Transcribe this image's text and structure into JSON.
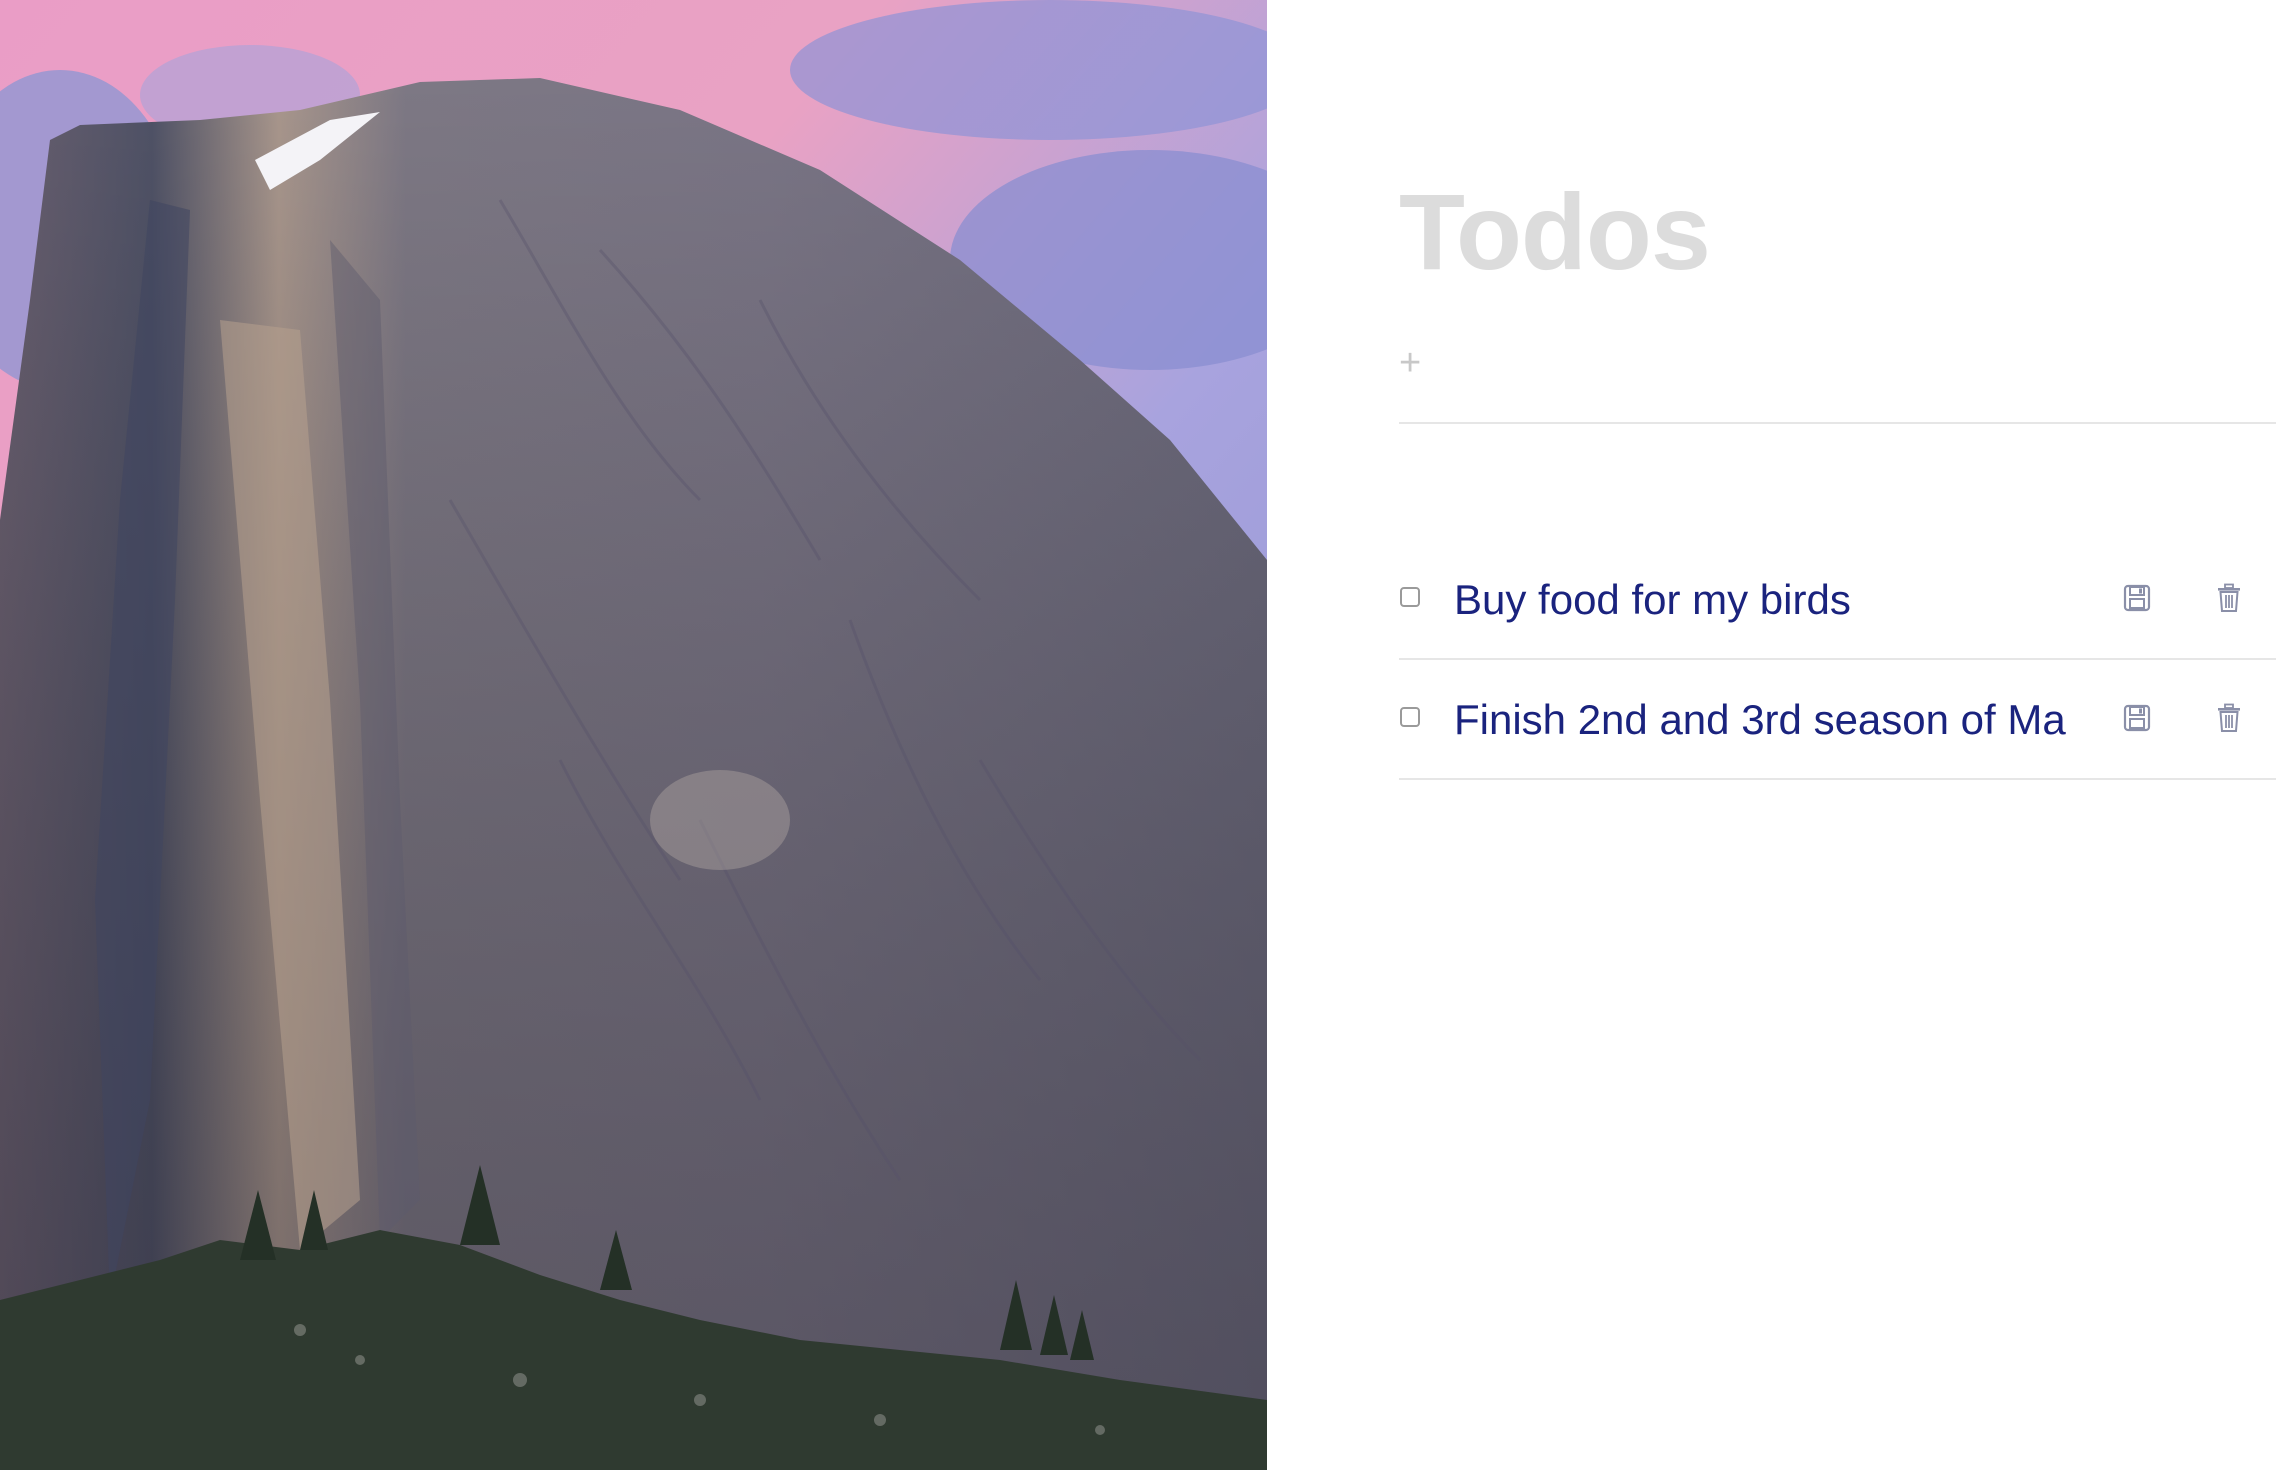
{
  "hero": {
    "image": "half-dome-yosemite-photo",
    "colors": {
      "sky_pink": "#e9a2c4",
      "sky_lavender": "#9aa0dc",
      "rock": "#6e6a7a",
      "rock_light": "#a29a98",
      "trees": "#2f3a30"
    }
  },
  "panel": {
    "title": "Todos",
    "add": {
      "icon": "plus-icon",
      "placeholder": "",
      "value": ""
    },
    "todos": [
      {
        "text": "Buy food for my birds",
        "completed": false,
        "save_icon": "floppy-disk-icon",
        "delete_icon": "trash-icon"
      },
      {
        "text": "Finish 2nd and 3rd season of Ma",
        "completed": false,
        "save_icon": "floppy-disk-icon",
        "delete_icon": "trash-icon"
      }
    ]
  },
  "colors": {
    "title": "#dcdcdc",
    "todo_text": "#1a237e",
    "divider": "#e6e6e6",
    "icon": "#8a8fa8"
  }
}
